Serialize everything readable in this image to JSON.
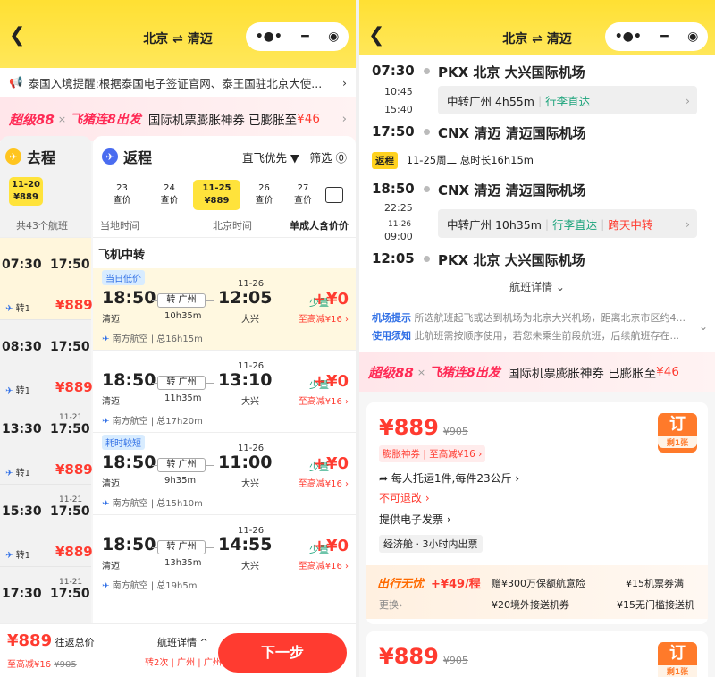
{
  "route": "北京 ⇌ 清迈",
  "notice": "泰国入境提醒:根据泰国电子签证官网、泰王国驻北京大使...",
  "promo": {
    "brand1": "超级88",
    "x": "×",
    "brand2": "飞猪连8出发",
    "text": "国际机票膨胀神券 已膨胀至",
    "amount": "¥46"
  },
  "left": {
    "tab_out": "去程",
    "tab_ret": "返程",
    "sort": "直飞优先 ▼",
    "filter": "筛选 ⓪",
    "out_date": "11-20",
    "out_price": "¥889",
    "total": "共43个航班",
    "dates": [
      {
        "d": "23",
        "p": "查价"
      },
      {
        "d": "24",
        "p": "查价"
      },
      {
        "d": "11-25",
        "p": "¥889"
      },
      {
        "d": "26",
        "p": "查价"
      },
      {
        "d": "27",
        "p": "查价"
      }
    ],
    "headers": {
      "local": "当地时间",
      "beijing": "北京时间",
      "price": "单成人含价价"
    },
    "section": "飞机中转",
    "outbound": [
      {
        "time": "07:30",
        "arr": "17:50",
        "sup": "",
        "stop": "转1",
        "price": "¥889"
      },
      {
        "time": "08:30",
        "arr": "17:50",
        "sup": "",
        "stop": "转1",
        "price": "¥889"
      },
      {
        "time": "13:30",
        "arr": "17:50",
        "sup": "11-21",
        "stop": "转1",
        "price": "¥889"
      },
      {
        "time": "15:30",
        "arr": "17:50",
        "sup": "11-21",
        "stop": "转1",
        "price": "¥889"
      },
      {
        "time": "17:30",
        "arr": "17:50",
        "sup": "11-21",
        "stop": "",
        "price": ""
      }
    ],
    "flights": [
      {
        "tag": "当日低价",
        "dep": "18:50",
        "arr": "12:05",
        "date": "11-26",
        "via": "转 广州",
        "from": "清迈",
        "dur": "10h35m",
        "to": "大兴",
        "few": "少量",
        "price": "+¥0",
        "disc": "至高减¥16 ›",
        "air": "南方航空 | 总16h15m"
      },
      {
        "tag": "",
        "dep": "18:50",
        "arr": "13:10",
        "date": "11-26",
        "via": "转 广州",
        "from": "清迈",
        "dur": "11h35m",
        "to": "大兴",
        "few": "少量",
        "price": "+¥0",
        "disc": "至高减¥16 ›",
        "air": "南方航空 | 总17h20m"
      },
      {
        "tag": "耗时较短",
        "dep": "18:50",
        "arr": "11:00",
        "date": "11-26",
        "via": "转 广州",
        "from": "清迈",
        "dur": "9h35m",
        "to": "大兴",
        "few": "少量",
        "price": "+¥0",
        "disc": "至高减¥16 ›",
        "air": "南方航空 | 总15h10m"
      },
      {
        "tag": "",
        "dep": "18:50",
        "arr": "14:55",
        "date": "11-26",
        "via": "转 广州",
        "from": "清迈",
        "dur": "13h35m",
        "to": "大兴",
        "few": "少量",
        "price": "+¥0",
        "disc": "至高减¥16 ›",
        "air": "南方航空 | 总19h5m"
      }
    ],
    "bottom": {
      "price": "¥889",
      "label": "往返总价",
      "disc": "至高减¥16",
      "orig": "¥905",
      "details": "航班详情 ^",
      "stops": "转2次 | 广州 | 广州",
      "next": "下一步"
    }
  },
  "right": {
    "out": {
      "t1": "07:30",
      "c1": "PKX 北京 大兴国际机场",
      "tr1": "10:45",
      "tr2": "15:40",
      "transfer": "中转广州 4h55m",
      "baggage": "行李直达",
      "t2": "17:50",
      "c2": "CNX 清迈 清迈国际机场"
    },
    "ret_badge": "返程",
    "ret_info": "11-25周二 总时长16h15m",
    "ret": {
      "t1": "18:50",
      "c1": "CNX 清迈 清迈国际机场",
      "tr1": "22:25",
      "tr_date": "11-26",
      "tr2": "09:00",
      "transfer": "中转广州 10h35m",
      "baggage": "行李直达",
      "cross": "跨天中转",
      "t2": "12:05",
      "c2": "PKX 北京 大兴国际机场"
    },
    "details": "航班详情 ⌄",
    "tip1_label": "机场提示",
    "tip1": "所选航班起飞或达到机场为北京大兴机场，距离北京市区约4...",
    "tip2_label": "使用须知",
    "tip2": "此航班需按顺序使用，若您未乘坐前段航班，后续航班存在...",
    "card1": {
      "price": "¥889",
      "orig": "¥905",
      "coupon": "膨胀神券 | 至高减¥16 ›",
      "book": "订",
      "left": "剩1张",
      "baggage": "每人托运1件,每件23公斤 ›",
      "refund": "不可退改 ›",
      "invoice": "提供电子发票 ›",
      "cabin": "经济舱 · 3小时内出票"
    },
    "worry": {
      "title": "出行无忧",
      "price": "+¥49/程",
      "change": "更换›",
      "items": [
        "赠¥300万保额航意险",
        "¥15机票券满",
        "¥20境外接送机券",
        "¥15无门槛接送机"
      ]
    },
    "card2": {
      "price": "¥889",
      "orig": "¥905",
      "book": "订",
      "left": "剩1张"
    }
  }
}
